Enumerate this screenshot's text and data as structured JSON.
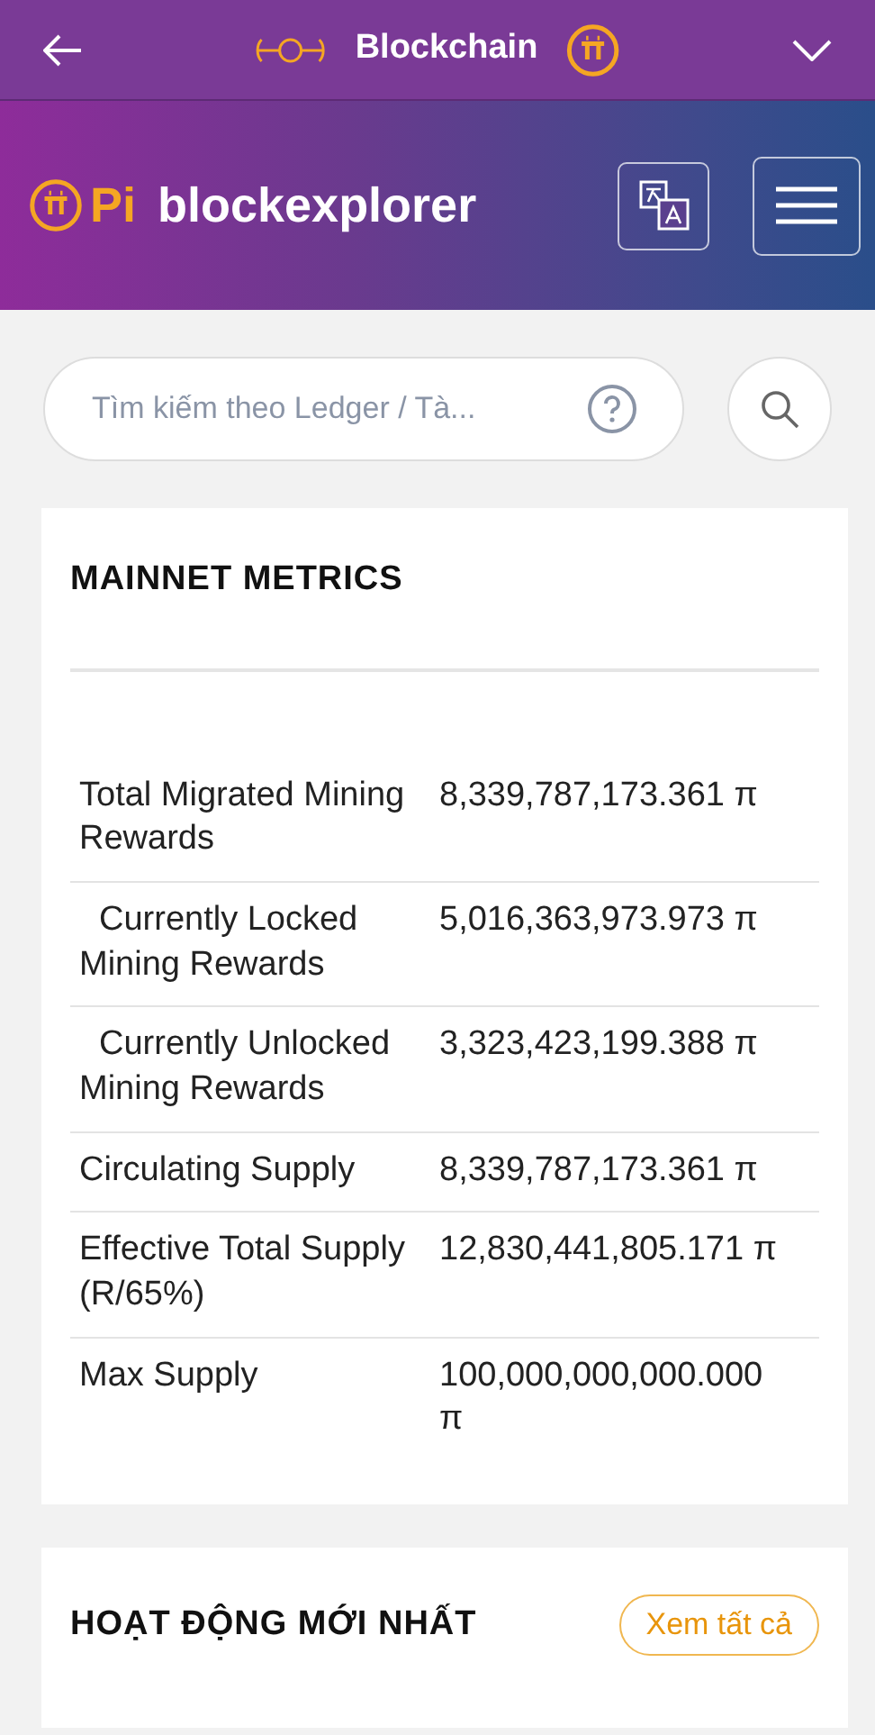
{
  "top_bar": {
    "title": "Blockchain"
  },
  "header": {
    "logo_pi": "Pi",
    "logo_text": "blockexplorer"
  },
  "search": {
    "placeholder": "Tìm kiếm theo Ledger / Tà..."
  },
  "metrics": {
    "title": "MAINNET METRICS",
    "rows": [
      {
        "label": "Total Migrated Mining Rewards",
        "value": "8,339,787,173.361 π",
        "indented": false
      },
      {
        "label": "Currently Locked Mining Rewards",
        "value": "5,016,363,973.973 π",
        "indented": true
      },
      {
        "label": "Currently Unlocked Mining Rewards",
        "value": "3,323,423,199.388 π",
        "indented": true
      },
      {
        "label": "Circulating Supply",
        "value": "8,339,787,173.361 π",
        "indented": false
      },
      {
        "label": "Effective Total Supply (R/65%)",
        "value": "12,830,441,805.171 π",
        "indented": false
      },
      {
        "label": "Max Supply",
        "value": "100,000,000,000.000 π",
        "indented": false
      }
    ]
  },
  "activity": {
    "title": "HOẠT ĐỘNG MỚI NHẤT",
    "view_all": "Xem tất cả"
  }
}
